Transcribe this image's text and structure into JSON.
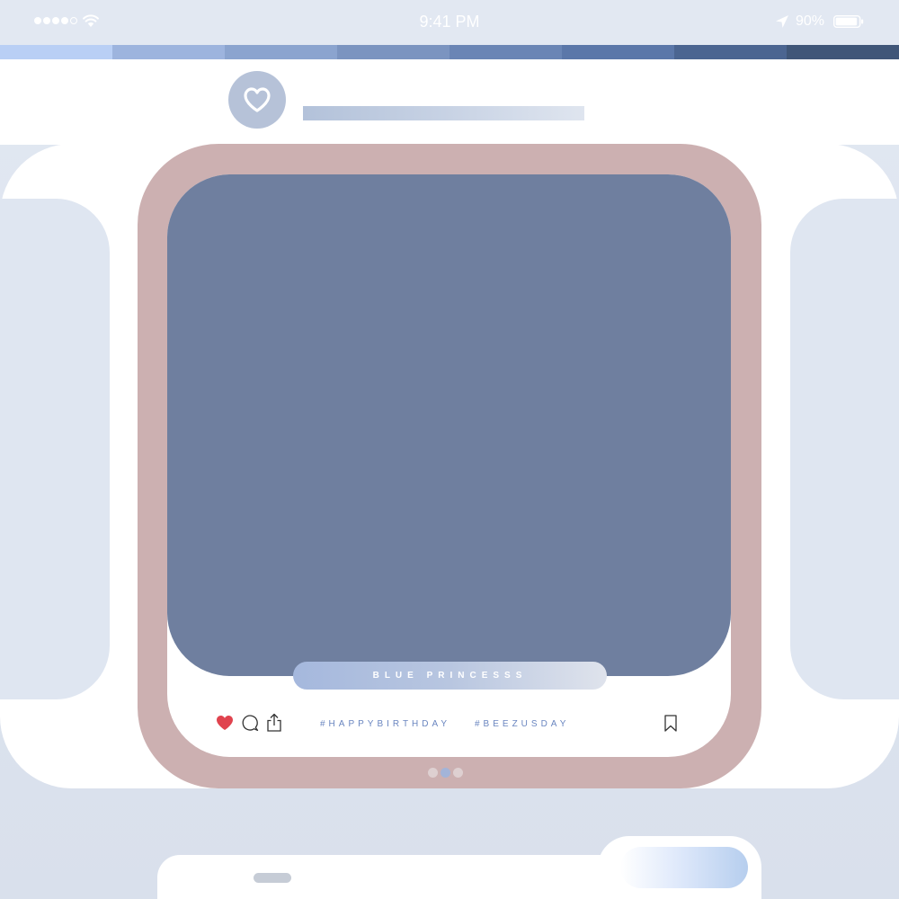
{
  "status_bar": {
    "time": "9:41 PM",
    "battery_percent": "90%",
    "signal_bars": 4,
    "signal_total": 5,
    "icons": [
      "signal-dots-icon",
      "wifi-icon",
      "location-arrow-icon",
      "battery-icon"
    ]
  },
  "palette": [
    "#b9cff5",
    "#9db4de",
    "#8ba4cf",
    "#7b94c0",
    "#6a85b5",
    "#5b77a9",
    "#4b6591",
    "#405678"
  ],
  "post": {
    "avatar_icon": "heart-icon",
    "caption": "BLUE PRINCESSS",
    "hashtags": [
      "#HAPPYBIRTHDAY",
      "#BEEZUSDAY"
    ],
    "liked": true,
    "actions": [
      "heart-icon",
      "comment-icon",
      "share-icon",
      "bookmark-icon"
    ],
    "page_count": 3,
    "active_page": 2
  },
  "colors": {
    "frame": "#ccb0b1",
    "photo": "#6f7f9f",
    "heart": "#e0434e",
    "hashtag": "#6a86c0",
    "background": "#dde4ef"
  }
}
